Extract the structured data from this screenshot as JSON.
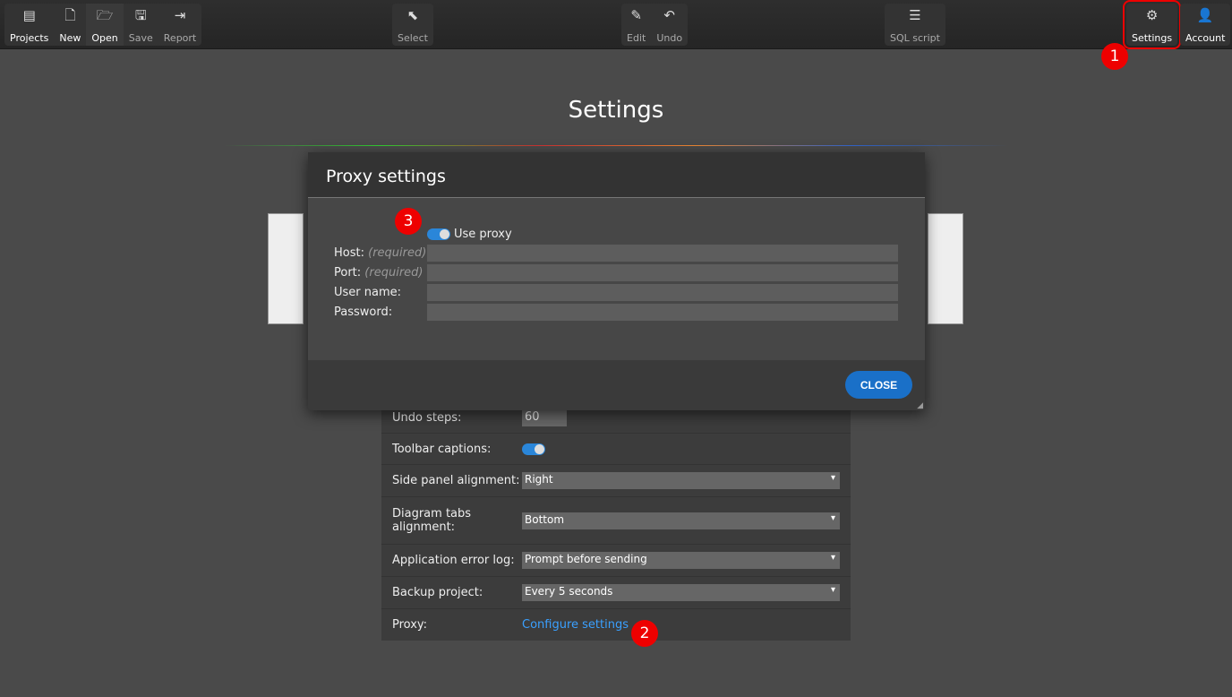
{
  "toolbar": {
    "projects": "Projects",
    "new": "New",
    "open": "Open",
    "save": "Save",
    "report": "Report",
    "select": "Select",
    "edit": "Edit",
    "undo": "Undo",
    "sql": "SQL script",
    "settings": "Settings",
    "account": "Account"
  },
  "page": {
    "title": "Settings"
  },
  "settings": {
    "undo_label": "Undo steps:",
    "undo_value": "60",
    "captions_label": "Toolbar captions:",
    "captions_on": true,
    "side_label": "Side panel alignment:",
    "side_value": "Right",
    "tabs_label": "Diagram tabs alignment:",
    "tabs_value": "Bottom",
    "errlog_label": "Application error log:",
    "errlog_value": "Prompt before sending",
    "backup_label": "Backup project:",
    "backup_value": "Every 5 seconds",
    "proxy_label": "Proxy:",
    "proxy_link": "Configure settings"
  },
  "modal": {
    "title": "Proxy settings",
    "use_proxy": "Use proxy",
    "use_proxy_on": true,
    "host": "Host:",
    "port": "Port:",
    "required": "(required)",
    "user": "User name:",
    "password": "Password:",
    "close": "CLOSE"
  },
  "badges": {
    "b1": "1",
    "b2": "2",
    "b3": "3"
  },
  "colors": {
    "accent": "#1a70c8",
    "link": "#3aa0ff",
    "badge": "#e00000"
  }
}
